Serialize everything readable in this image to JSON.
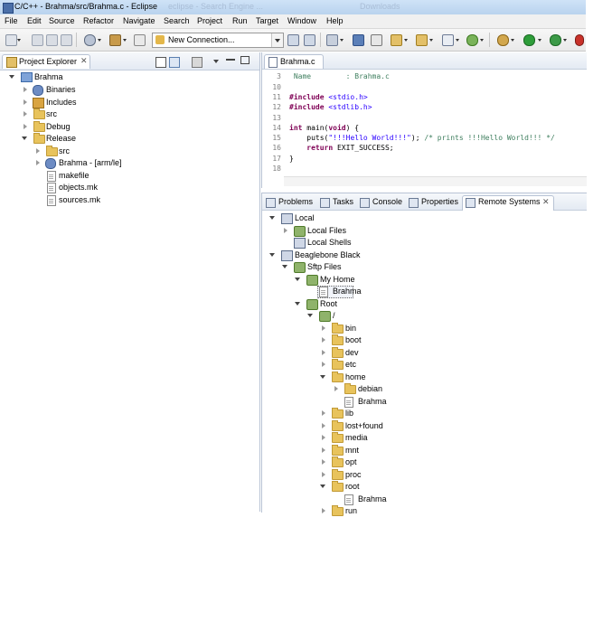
{
  "window": {
    "title": "C/C++ - Brahma/src/Brahma.c - Eclipse",
    "ghost_text_1": "eclipse - Search Engine ...",
    "ghost_text_2": "Downloads"
  },
  "menu": [
    "File",
    "Edit",
    "Source",
    "Refactor",
    "Navigate",
    "Search",
    "Project",
    "Run",
    "Target",
    "Window",
    "Help"
  ],
  "toolbar": {
    "connection_select": "New Connection..."
  },
  "project_explorer": {
    "tab_label": "Project Explorer",
    "close_glyph": "✕",
    "tree": [
      {
        "label": "Brahma",
        "icon": "project-icon",
        "expanded": true
      },
      {
        "label": "Binaries",
        "icon": "binaries-icon"
      },
      {
        "label": "Includes",
        "icon": "includes-icon"
      },
      {
        "label": "src",
        "icon": "folder-icon"
      },
      {
        "label": "Debug",
        "icon": "folder-icon"
      },
      {
        "label": "Release",
        "icon": "folder-icon",
        "expanded": true
      },
      {
        "label": "src",
        "icon": "folder-icon"
      },
      {
        "label": "Brahma - [arm/le]",
        "icon": "binary-icon"
      },
      {
        "label": "makefile",
        "icon": "file-icon"
      },
      {
        "label": "objects.mk",
        "icon": "file-icon"
      },
      {
        "label": "sources.mk",
        "icon": "file-icon"
      }
    ]
  },
  "editor": {
    "tab_label": "Brahma.c",
    "lines": [
      {
        "n": "3",
        "segments": [
          {
            "t": " Name        : Brahma.c",
            "c": "com"
          }
        ]
      },
      {
        "n": "10",
        "segments": []
      },
      {
        "n": "11",
        "segments": [
          {
            "t": "#include",
            "c": "pp"
          },
          {
            "t": " <stdio.h>",
            "c": "str"
          }
        ]
      },
      {
        "n": "12",
        "segments": [
          {
            "t": "#include",
            "c": "pp"
          },
          {
            "t": " <stdlib.h>",
            "c": "str"
          }
        ]
      },
      {
        "n": "13",
        "segments": []
      },
      {
        "n": "14",
        "segments": [
          {
            "t": "int",
            "c": "kw"
          },
          {
            "t": " main(",
            "c": ""
          },
          {
            "t": "void",
            "c": "kw"
          },
          {
            "t": ") {",
            "c": ""
          }
        ]
      },
      {
        "n": "15",
        "segments": [
          {
            "t": "    puts(",
            "c": ""
          },
          {
            "t": "\"!!!Hello World!!!\"",
            "c": "str"
          },
          {
            "t": "); ",
            "c": ""
          },
          {
            "t": "/* prints !!!Hello World!!! */",
            "c": "com"
          }
        ]
      },
      {
        "n": "16",
        "segments": [
          {
            "t": "    ",
            "c": ""
          },
          {
            "t": "return",
            "c": "kw"
          },
          {
            "t": " EXIT_SUCCESS;",
            "c": ""
          }
        ]
      },
      {
        "n": "17",
        "segments": [
          {
            "t": "}",
            "c": ""
          }
        ]
      },
      {
        "n": "18",
        "segments": []
      }
    ]
  },
  "bottom_tabs": [
    {
      "label": "Problems",
      "active": false
    },
    {
      "label": "Tasks",
      "active": false
    },
    {
      "label": "Console",
      "active": false
    },
    {
      "label": "Properties",
      "active": false
    },
    {
      "label": "Remote Systems",
      "active": true
    }
  ],
  "remote_tree": [
    {
      "label": "Local",
      "depth": 0,
      "twisty": "down",
      "icon": "computer-icon"
    },
    {
      "label": "Local Files",
      "depth": 1,
      "twisty": "right",
      "icon": "files-icon"
    },
    {
      "label": "Local Shells",
      "depth": 1,
      "twisty": "none",
      "icon": "shell-icon"
    },
    {
      "label": "Beaglebone Black",
      "depth": 0,
      "twisty": "down",
      "icon": "computer-icon"
    },
    {
      "label": "Sftp Files",
      "depth": 1,
      "twisty": "down",
      "icon": "files-icon"
    },
    {
      "label": "My Home",
      "depth": 2,
      "twisty": "down",
      "icon": "files-icon"
    },
    {
      "label": "Brahma",
      "depth": 3,
      "twisty": "none",
      "icon": "file-icon",
      "selected": true
    },
    {
      "label": "Root",
      "depth": 2,
      "twisty": "down",
      "icon": "files-icon"
    },
    {
      "label": "/",
      "depth": 3,
      "twisty": "down",
      "icon": "drive-icon"
    },
    {
      "label": "bin",
      "depth": 4,
      "twisty": "right",
      "icon": "folder-icon"
    },
    {
      "label": "boot",
      "depth": 4,
      "twisty": "right",
      "icon": "folder-icon"
    },
    {
      "label": "dev",
      "depth": 4,
      "twisty": "right",
      "icon": "folder-icon"
    },
    {
      "label": "etc",
      "depth": 4,
      "twisty": "right",
      "icon": "folder-icon"
    },
    {
      "label": "home",
      "depth": 4,
      "twisty": "down",
      "icon": "folder-open-icon"
    },
    {
      "label": "debian",
      "depth": 5,
      "twisty": "right",
      "icon": "folder-icon"
    },
    {
      "label": "Brahma",
      "depth": 5,
      "twisty": "none",
      "icon": "file-icon"
    },
    {
      "label": "lib",
      "depth": 4,
      "twisty": "right",
      "icon": "folder-icon"
    },
    {
      "label": "lost+found",
      "depth": 4,
      "twisty": "right",
      "icon": "folder-icon"
    },
    {
      "label": "media",
      "depth": 4,
      "twisty": "right",
      "icon": "folder-icon"
    },
    {
      "label": "mnt",
      "depth": 4,
      "twisty": "right",
      "icon": "folder-icon"
    },
    {
      "label": "opt",
      "depth": 4,
      "twisty": "right",
      "icon": "folder-icon"
    },
    {
      "label": "proc",
      "depth": 4,
      "twisty": "right",
      "icon": "folder-icon"
    },
    {
      "label": "root",
      "depth": 4,
      "twisty": "down",
      "icon": "folder-open-icon"
    },
    {
      "label": "Brahma",
      "depth": 5,
      "twisty": "none",
      "icon": "file-icon"
    },
    {
      "label": "run",
      "depth": 4,
      "twisty": "right",
      "icon": "folder-icon"
    }
  ]
}
